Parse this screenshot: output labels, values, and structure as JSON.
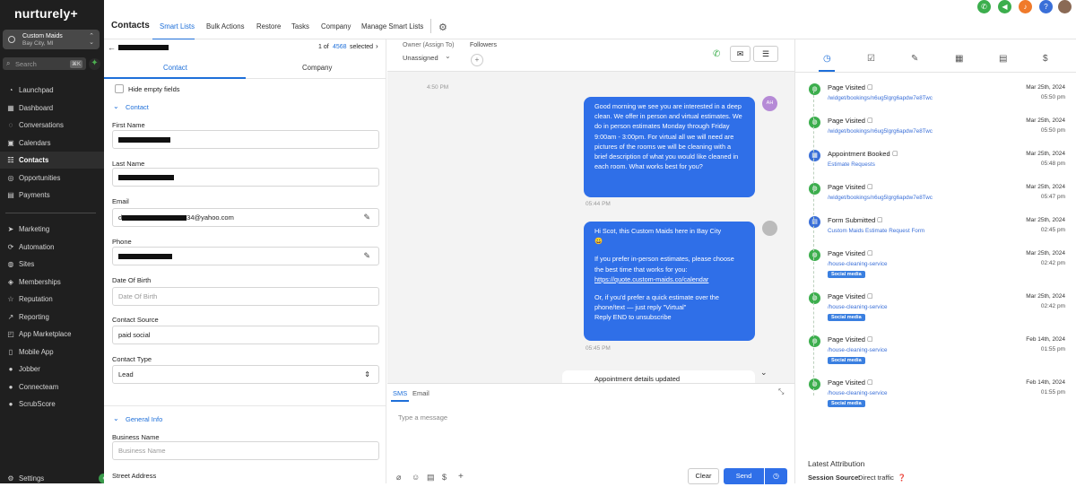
{
  "brand": {
    "name": "nurturely+"
  },
  "account": {
    "name": "Custom Maids",
    "location": "Bay City, MI"
  },
  "search": {
    "placeholder": "Search",
    "shortcut": "⌘K"
  },
  "nav1": [
    {
      "label": "Launchpad",
      "icon": "rocket-icon",
      "glyph": "◔"
    },
    {
      "label": "Dashboard",
      "icon": "dashboard-icon",
      "glyph": "▦"
    },
    {
      "label": "Conversations",
      "icon": "chat-icon",
      "glyph": "◌"
    },
    {
      "label": "Calendars",
      "icon": "calendar-icon",
      "glyph": "▣"
    },
    {
      "label": "Contacts",
      "icon": "contacts-icon",
      "glyph": "☷"
    },
    {
      "label": "Opportunities",
      "icon": "funnel-icon",
      "glyph": "◎"
    },
    {
      "label": "Payments",
      "icon": "payments-icon",
      "glyph": "▤"
    }
  ],
  "nav2": [
    {
      "label": "Marketing",
      "icon": "send-icon",
      "glyph": "➤"
    },
    {
      "label": "Automation",
      "icon": "automation-icon",
      "glyph": "⟳"
    },
    {
      "label": "Sites",
      "icon": "globe-icon",
      "glyph": "◍"
    },
    {
      "label": "Memberships",
      "icon": "membership-icon",
      "glyph": "◈"
    },
    {
      "label": "Reputation",
      "icon": "star-icon",
      "glyph": "☆"
    },
    {
      "label": "Reporting",
      "icon": "chart-icon",
      "glyph": "↗"
    },
    {
      "label": "App Marketplace",
      "icon": "marketplace-icon",
      "glyph": "◰"
    },
    {
      "label": "Mobile App",
      "icon": "mobile-icon",
      "glyph": "▯"
    },
    {
      "label": "Jobber",
      "icon": "jobber-icon",
      "glyph": "●"
    },
    {
      "label": "Connecteam",
      "icon": "team-icon",
      "glyph": "●"
    },
    {
      "label": "ScrubScore",
      "icon": "scrub-icon",
      "glyph": "●"
    }
  ],
  "settings": {
    "label": "Settings"
  },
  "header": {
    "title": "Contacts",
    "tabs": [
      "Smart Lists",
      "Bulk Actions",
      "Restore",
      "Tasks",
      "Company",
      "Manage Smart Lists"
    ]
  },
  "pager": {
    "current": "1 of",
    "total": "4568",
    "suffix": "selected"
  },
  "contact_tabs": [
    "Contact",
    "Company"
  ],
  "hide_empty": "Hide empty fields",
  "section_contact": "Contact",
  "fields": {
    "first_name": {
      "label": "First Name"
    },
    "last_name": {
      "label": "Last Name"
    },
    "email": {
      "label": "Email",
      "value_prefix": "d",
      "value_suffix": "34@yahoo.com"
    },
    "phone": {
      "label": "Phone"
    },
    "dob": {
      "label": "Date Of Birth",
      "placeholder": "Date Of Birth"
    },
    "source": {
      "label": "Contact Source",
      "value": "paid social"
    },
    "type": {
      "label": "Contact Type",
      "value": "Lead"
    }
  },
  "section_general": "General Info",
  "business": {
    "label": "Business Name",
    "placeholder": "Business Name"
  },
  "street": {
    "label": "Street Address"
  },
  "owner": {
    "label": "Owner (Assign To)",
    "value": "Unassigned"
  },
  "followers": {
    "label": "Followers"
  },
  "messages": [
    {
      "time": "4:50 PM"
    },
    {
      "text": "Good morning we see you are interested in a deep clean. We offer in person and virtual estimates. We do in person estimates Monday through Friday 9:00am - 3:00pm. For virtual all we will need are pictures of the rooms we will be cleaning with a brief description of what you would like cleaned in each room. What works best for you?",
      "time": "05:44 PM",
      "avatar": "AH"
    },
    {
      "line1": "Hi Scot, this Custom Maids here in Bay City",
      "line2": "😀",
      "line3": "If you prefer in-person estimates, please choose the best time that works for you:",
      "link": "https://quote.custom-maids.co/calendar",
      "line4": "Or, if you'd prefer a quick estimate over the phone/text — just reply \"Virtual\"",
      "line5": "Reply END to unsubscribe",
      "time": "05:45 PM"
    }
  ],
  "appointment_note": "Appointment details updated",
  "composer": {
    "tabs": [
      "SMS",
      "Email"
    ],
    "placeholder": "Type a message",
    "clear": "Clear",
    "send": "Send"
  },
  "timeline": [
    {
      "title": "Page Visited",
      "sub": "/widget/bookings/n6ug5lgrg6apdw7e8Twc",
      "date": "Mar 25th, 2024",
      "time": "05:50 pm",
      "icon": "globe-icon",
      "color": "green"
    },
    {
      "title": "Page Visited",
      "sub": "/widget/bookings/n6ug5lgrg6apdw7e8Twc",
      "date": "Mar 25th, 2024",
      "time": "05:50 pm",
      "icon": "globe-icon",
      "color": "green"
    },
    {
      "title": "Appointment Booked",
      "sub": "Estimate Requests",
      "date": "Mar 25th, 2024",
      "time": "05:48 pm",
      "icon": "calendar-icon",
      "color": "blue"
    },
    {
      "title": "Page Visited",
      "sub": "/widget/bookings/n6ug5lgrg6apdw7e8Twc",
      "date": "Mar 25th, 2024",
      "time": "05:47 pm",
      "icon": "globe-icon",
      "color": "green"
    },
    {
      "title": "Form Submitted",
      "sub": "Custom Maids Estimate Request Form",
      "date": "Mar 25th, 2024",
      "time": "02:45 pm",
      "icon": "form-icon",
      "color": "blue"
    },
    {
      "title": "Page Visited",
      "sub": "/house-cleaning-service",
      "badge": "Social media",
      "date": "Mar 25th, 2024",
      "time": "02:42 pm",
      "icon": "globe-icon",
      "color": "green"
    },
    {
      "title": "Page Visited",
      "sub": "/house-cleaning-service",
      "badge": "Social media",
      "date": "Mar 25th, 2024",
      "time": "02:42 pm",
      "icon": "globe-icon",
      "color": "green"
    },
    {
      "title": "Page Visited",
      "sub": "/house-cleaning-service",
      "badge": "Social media",
      "date": "Feb 14th, 2024",
      "time": "01:55 pm",
      "icon": "globe-icon",
      "color": "green"
    },
    {
      "title": "Page Visited",
      "sub": "/house-cleaning-service",
      "badge": "Social media",
      "date": "Feb 14th, 2024",
      "time": "01:55 pm",
      "icon": "globe-icon",
      "color": "green"
    }
  ],
  "attribution": {
    "title": "Latest Attribution",
    "label": "Session Source:",
    "value": "Direct traffic"
  },
  "colors": {
    "accent": "#1e6fd9",
    "sidebar": "#1f1f1f",
    "bubble": "#2f6fe8",
    "green": "#3cae4d"
  }
}
